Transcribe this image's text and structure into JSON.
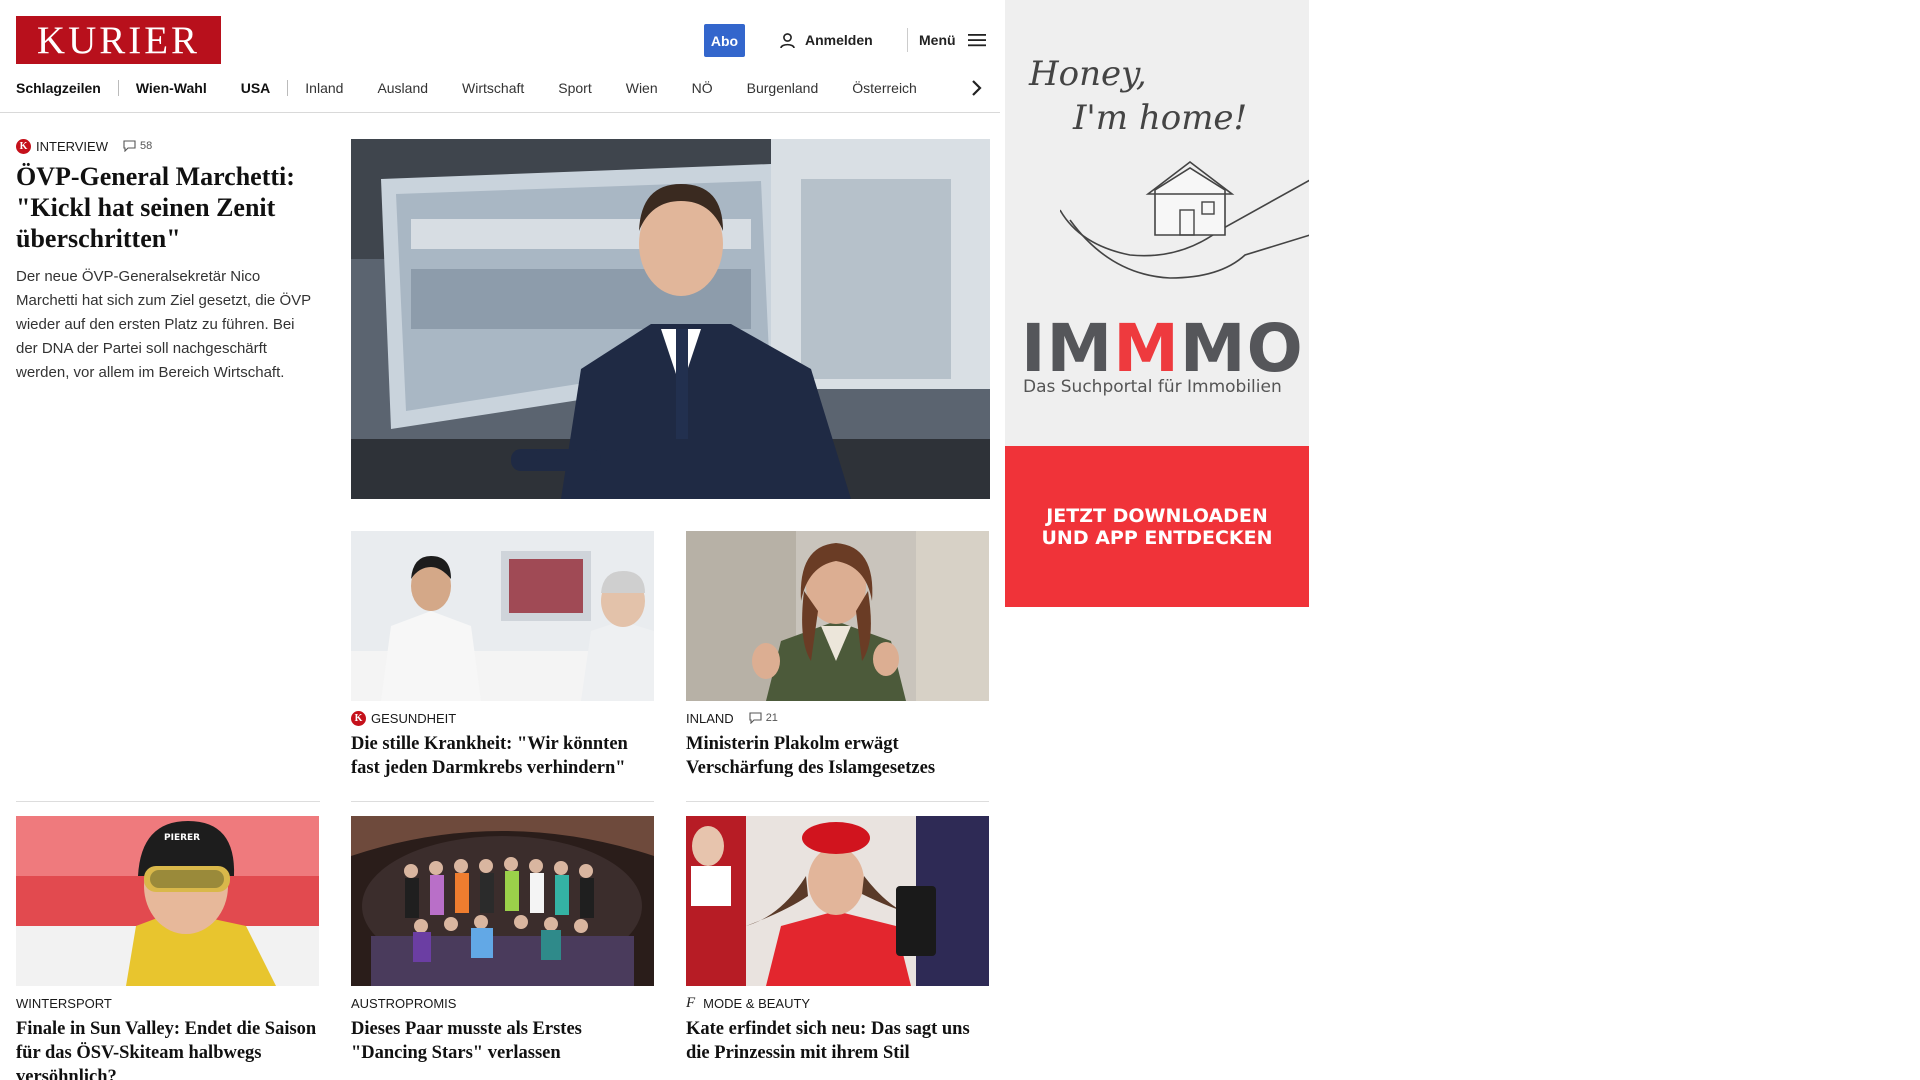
{
  "header": {
    "logo": "KURIER",
    "abo_label": "Abo",
    "login_label": "Anmelden",
    "menu_label": "Menü"
  },
  "nav": {
    "items": [
      "Schlagzeilen",
      "Wien-Wahl",
      "USA",
      "Inland",
      "Ausland",
      "Wirtschaft",
      "Sport",
      "Wien",
      "NÖ",
      "Burgenland",
      "Österreich"
    ]
  },
  "lead": {
    "badge": "K",
    "kicker": "Interview",
    "comments": "58",
    "headline": "ÖVP-General Marchetti: \"Kickl hat seinen Zenit überschritten\"",
    "teaser": "Der neue ÖVP-Generalsekretär Nico Marchetti hat sich zum Ziel gesetzt, die ÖVP wieder auf den ersten Platz zu führen. Bei der DNA der Partei soll nachgeschärft werden, vor allem im Bereich Wirtschaft."
  },
  "cards": [
    {
      "kicker": "Gesundheit",
      "badge": "K",
      "headline": "Die stille Krankheit: \"Wir könnten fast jeden Darmkrebs verhindern\""
    },
    {
      "kicker": "Inland",
      "comments": "21",
      "headline": "Ministerin Plakolm erwägt Verschärfung des Islamgesetzes"
    },
    {
      "kicker": "Wintersport",
      "headline": "Finale in Sun Valley: Endet die Saison für das ÖSV-Skiteam halbwegs versöhnlich?"
    },
    {
      "kicker": "Austropromis",
      "headline": "Dieses Paar musste als Erstes \"Dancing Stars\" verlassen"
    },
    {
      "kicker": "Mode & Beauty",
      "badge": "f",
      "headline": "Kate erfindet sich neu: Das sagt uns die Prinzessin mit ihrem Stil"
    }
  ],
  "ad": {
    "script_line1": "Honey,",
    "script_line2": "I'm home!",
    "brand_a": "IM",
    "brand_b": "M",
    "brand_c": "MO",
    "tagline": "Das Suchportal für Immobilien",
    "cta_line1": "JETZT DOWNLOADEN",
    "cta_line2": "UND APP ENTDECKEN"
  },
  "colors": {
    "brand_red": "#b8101c",
    "abo_blue": "#3366cc",
    "ad_red": "#f03339"
  }
}
